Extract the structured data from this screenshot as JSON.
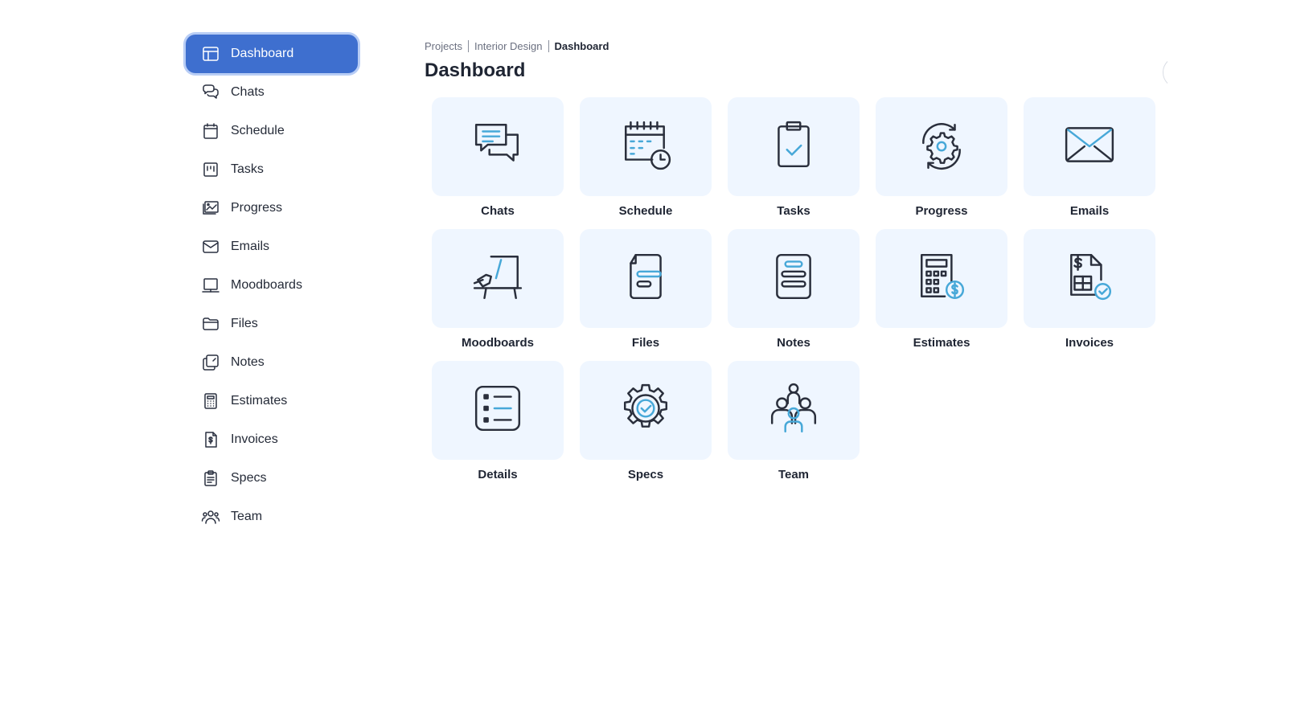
{
  "sidebar": {
    "items": [
      {
        "label": "Dashboard",
        "icon": "dashboard-icon",
        "active": true
      },
      {
        "label": "Chats",
        "icon": "chats-icon"
      },
      {
        "label": "Schedule",
        "icon": "calendar-icon"
      },
      {
        "label": "Tasks",
        "icon": "tasks-icon"
      },
      {
        "label": "Progress",
        "icon": "progress-icon"
      },
      {
        "label": "Emails",
        "icon": "envelope-icon"
      },
      {
        "label": "Moodboards",
        "icon": "moodboard-icon"
      },
      {
        "label": "Files",
        "icon": "folder-icon"
      },
      {
        "label": "Notes",
        "icon": "notes-icon"
      },
      {
        "label": "Estimates",
        "icon": "calculator-icon"
      },
      {
        "label": "Invoices",
        "icon": "invoice-icon"
      },
      {
        "label": "Specs",
        "icon": "clipboard-icon"
      },
      {
        "label": "Team",
        "icon": "team-icon"
      }
    ]
  },
  "breadcrumb": [
    "Projects",
    "Interior Design",
    "Dashboard"
  ],
  "page_title": "Dashboard",
  "tiles": [
    {
      "label": "Chats",
      "icon": "chat-bubbles-icon"
    },
    {
      "label": "Schedule",
      "icon": "calendar-clock-icon"
    },
    {
      "label": "Tasks",
      "icon": "clipboard-check-icon"
    },
    {
      "label": "Progress",
      "icon": "gear-cycle-icon"
    },
    {
      "label": "Emails",
      "icon": "envelope-icon"
    },
    {
      "label": "Moodboards",
      "icon": "easel-icon"
    },
    {
      "label": "Files",
      "icon": "document-icon"
    },
    {
      "label": "Notes",
      "icon": "notes-icon"
    },
    {
      "label": "Estimates",
      "icon": "calculator-dollar-icon"
    },
    {
      "label": "Invoices",
      "icon": "invoice-check-icon"
    },
    {
      "label": "Details",
      "icon": "list-icon"
    },
    {
      "label": "Specs",
      "icon": "gear-check-icon"
    },
    {
      "label": "Team",
      "icon": "team-icon"
    }
  ],
  "colors": {
    "accent": "#3e6fcf",
    "tile_bg": "#eff6ff",
    "icon_accent": "#47a8d8"
  }
}
